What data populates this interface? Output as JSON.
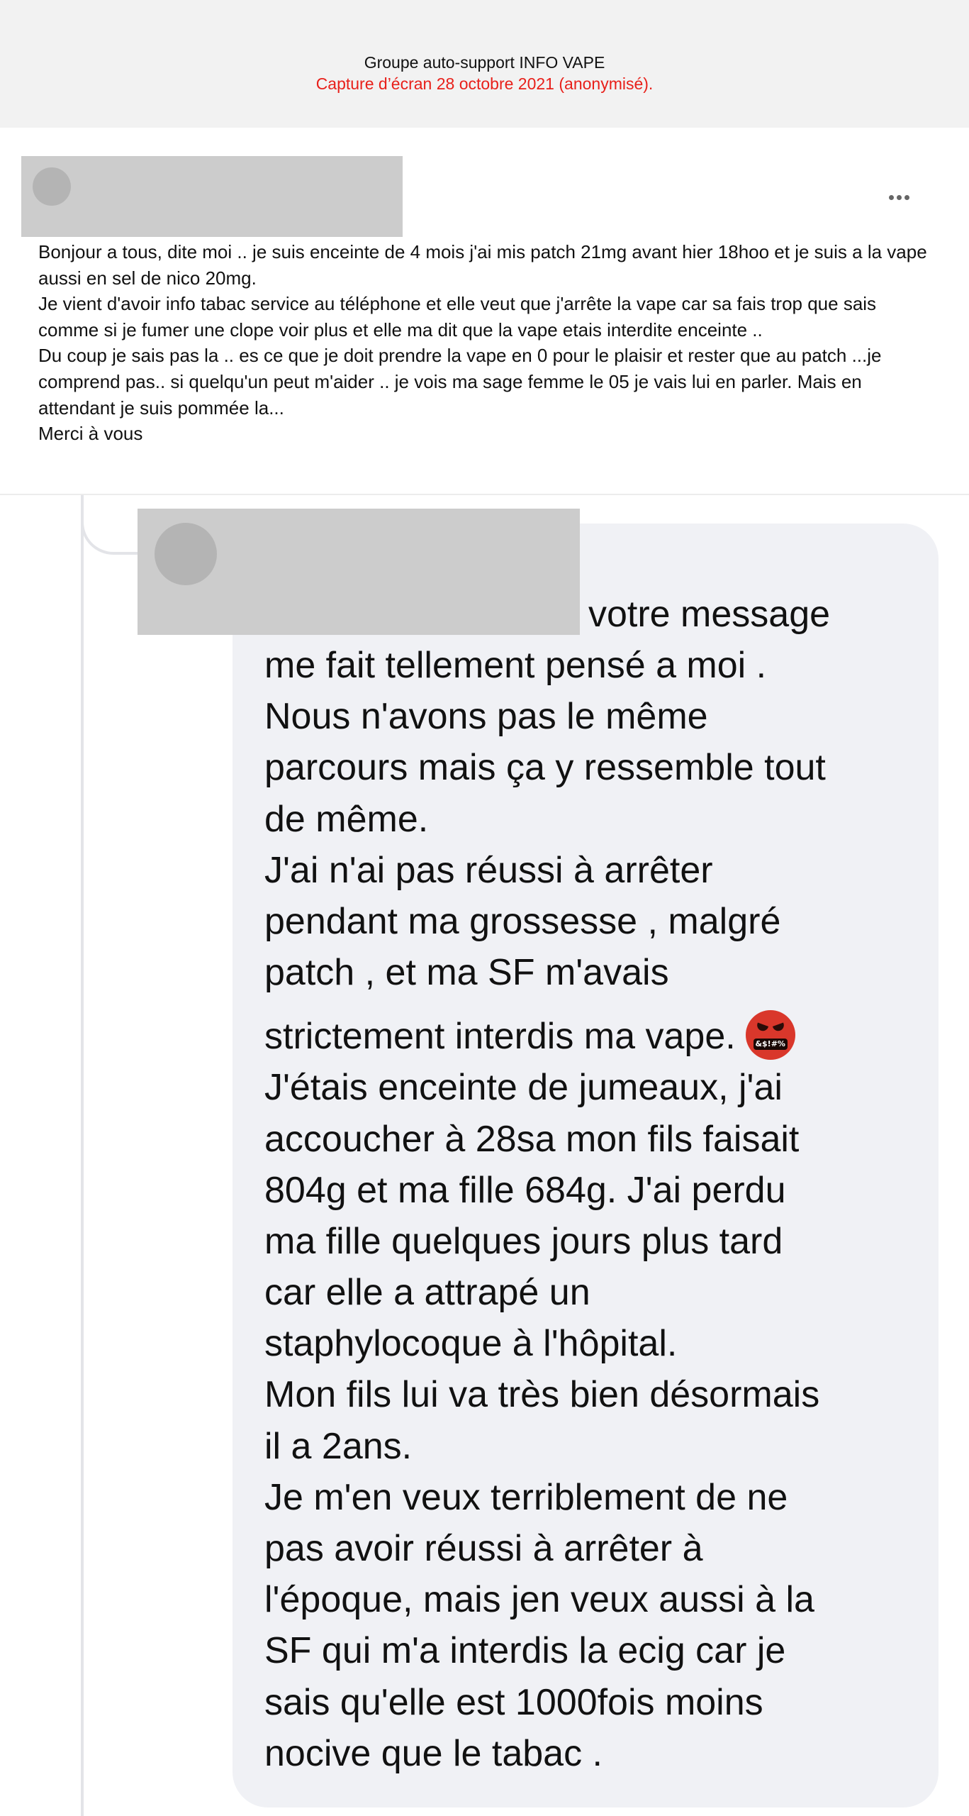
{
  "caption": {
    "title": "Groupe auto-support INFO VAPE",
    "subtitle": "Capture d’écran 28 octobre 2021 (anonymisé)."
  },
  "post": {
    "more_icon": "more-horizontal-icon",
    "lines": [
      "Bonjour a tous, dite moi .. je suis enceinte de 4 mois j'ai mis patch 21mg avant hier 18hoo et je suis a la vape aussi en sel de nico 20mg.",
      "Je vient d'avoir info tabac service au téléphone et elle veut que j'arrête la vape car sa fais trop que sais comme si je fumer une clope voir plus et elle ma dit que la vape etais interdite enceinte ..",
      "Du coup je sais pas la .. es ce que je doit prendre la vape en 0 pour le plaisir et rester que au patch ...je comprend pas.. si quelqu'un peut m'aider .. je vois ma sage femme le 05 je vais lui en parler. Mais en attendant je suis pommée la...",
      "Merci à vous"
    ]
  },
  "comment": {
    "first_line": "votre message",
    "lines": [
      "me fait tellement pensé a moi .",
      "Nous n'avons pas le même",
      "parcours mais ça y ressemble tout",
      "de même.",
      "J'ai n'ai pas réussi à arrêter",
      "pendant ma grossesse , malgré",
      "patch , et ma SF m'avais",
      "strictement interdis ma vape.",
      "J'étais enceinte de jumeaux, j'ai",
      "accoucher à 28sa mon fils faisait",
      "804g et ma fille 684g. J'ai perdu",
      "ma fille quelques jours plus tard",
      "car elle a attrapé un",
      "staphylocoque à l'hôpital.",
      "Mon fils lui va très bien désormais",
      "il a 2ans.",
      "Je m'en veux terriblement de ne",
      "pas avoir réussi à arrêter à",
      "l'époque,  mais jen veux aussi à la",
      "SF qui m'a interdis la ecig car je",
      "sais qu'elle est 1000fois moins",
      "nocive que le tabac ."
    ],
    "emoji": "angry-cursing-face-icon",
    "emoji_symbols": "&$!#%"
  },
  "colors": {
    "caption_band": "#f2f2f2",
    "subtitle_red": "#e8201a",
    "redaction_gray": "#cccccc",
    "avatar_gray": "#b4b4b4",
    "bubble_bg": "#f0f1f5",
    "thread_line": "#e3e4e8"
  }
}
